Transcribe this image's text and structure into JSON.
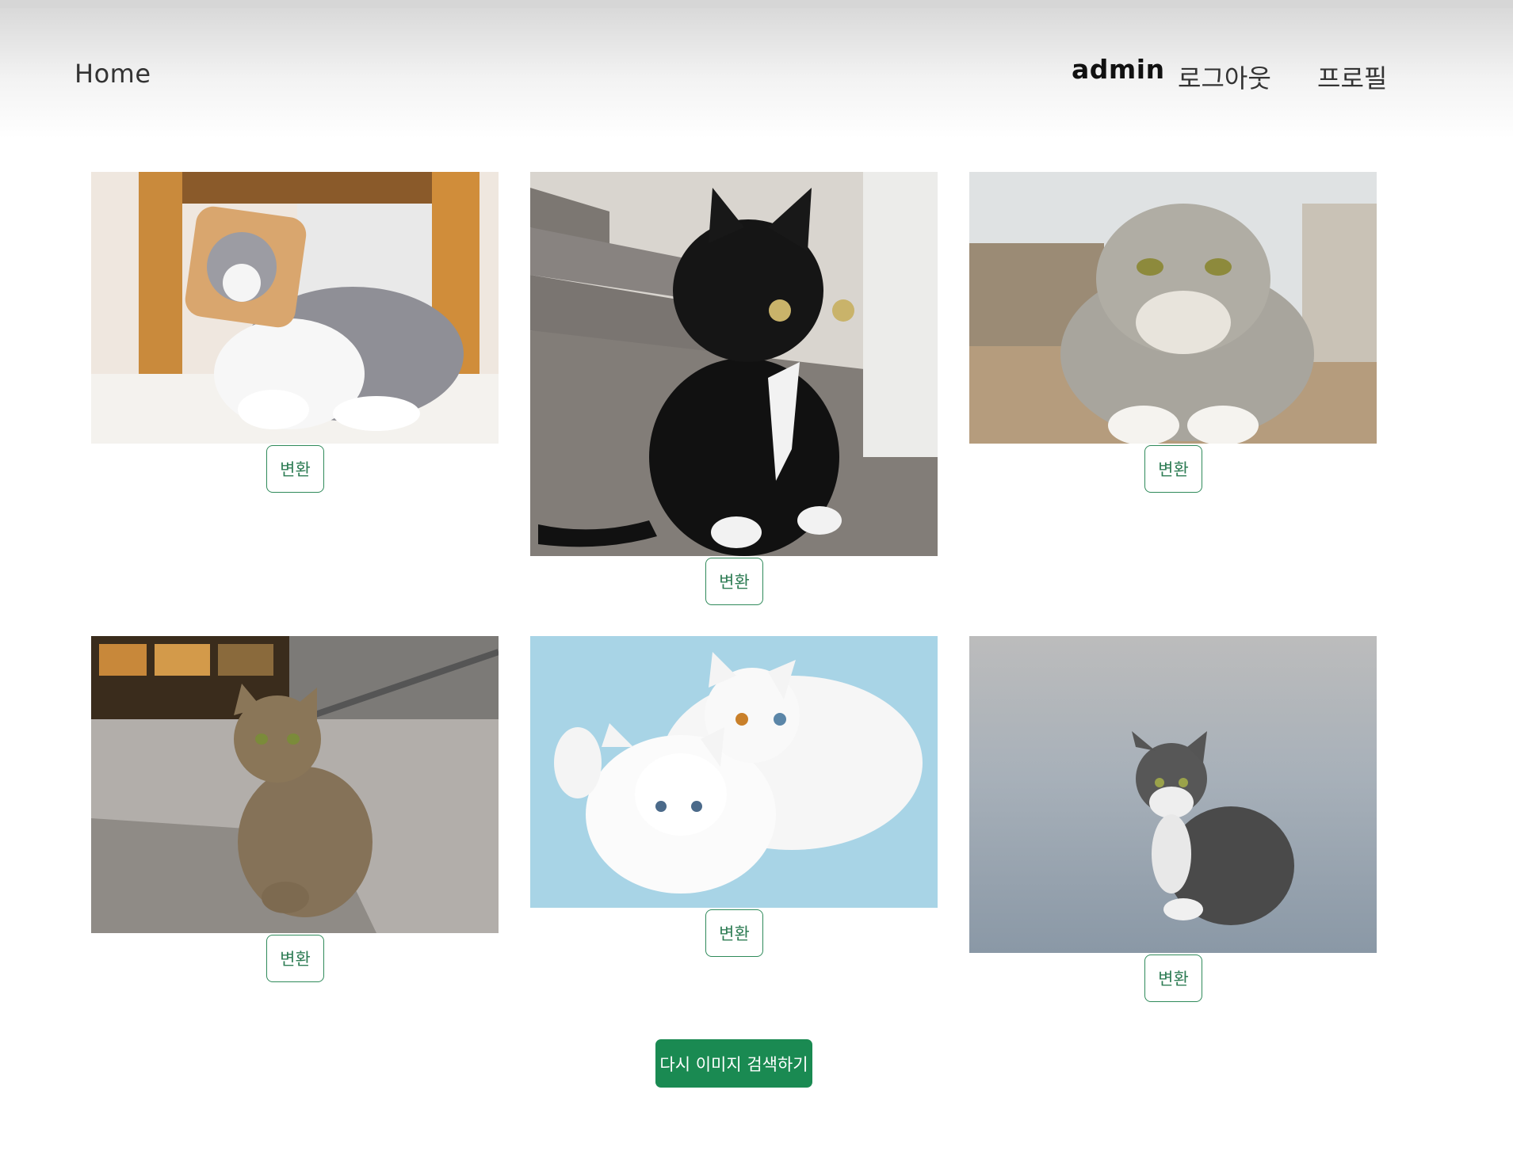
{
  "header": {
    "home_label": "Home",
    "user_label": "admin",
    "logout_label": "로그아웃",
    "profile_label": "프로필"
  },
  "gallery": {
    "items": [
      {
        "image_name": "cat-bread-on-head-image",
        "convert_label": "변환"
      },
      {
        "image_name": "black-cat-on-stairs-image",
        "convert_label": "변환"
      },
      {
        "image_name": "scottish-fold-cat-image",
        "convert_label": "변환"
      },
      {
        "image_name": "tabby-cat-on-granite-floor-image",
        "convert_label": "변환"
      },
      {
        "image_name": "two-white-cats-image",
        "convert_label": "변환"
      },
      {
        "image_name": "striped-cat-outdoors-image",
        "convert_label": "변환"
      }
    ]
  },
  "footer": {
    "search_again_label": "다시 이미지 검색하기"
  },
  "colors": {
    "accent": "#1a8a52",
    "button_border": "#2f8a5a"
  }
}
